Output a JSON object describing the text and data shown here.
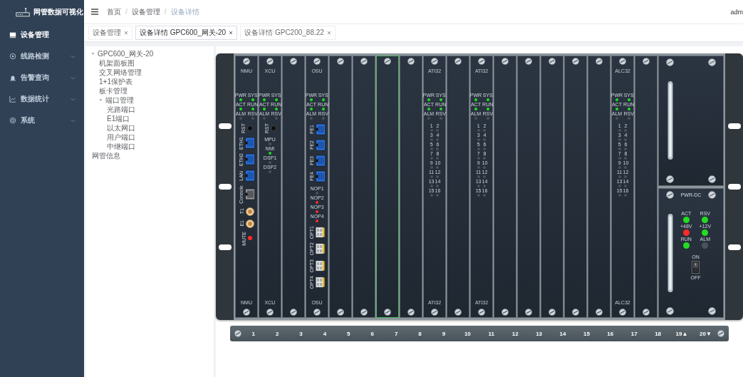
{
  "sidebar": {
    "title": "网管数据可视化",
    "items": [
      {
        "label": "设备管理",
        "selected": true,
        "has_children": false
      },
      {
        "label": "线路检测",
        "selected": false,
        "has_children": true
      },
      {
        "label": "告警查询",
        "selected": false,
        "has_children": true
      },
      {
        "label": "数据统计",
        "selected": false,
        "has_children": true
      },
      {
        "label": "系统",
        "selected": false,
        "has_children": true
      }
    ]
  },
  "breadcrumb": [
    "首页",
    "设备管理",
    "设备详情"
  ],
  "breadcrumb_separator": "/",
  "user": "adm",
  "tabs": [
    {
      "label": "设备管理",
      "selected": false
    },
    {
      "label": "设备详情 GPC600_网关-20",
      "selected": true
    },
    {
      "label": "设备详情 GPC200_88.22",
      "selected": false
    }
  ],
  "tree": [
    {
      "label": "GPC600_网关-20",
      "expanded": true,
      "children": [
        {
          "label": "机架面板图"
        },
        {
          "label": "交叉网络管理"
        },
        {
          "label": "1+1保护表"
        },
        {
          "label": "板卡管理"
        },
        {
          "label": "端口管理",
          "expanded": true,
          "children": [
            {
              "label": "光路端口"
            },
            {
              "label": "E1端口"
            },
            {
              "label": "以太网口"
            },
            {
              "label": "用户端口"
            },
            {
              "label": "中继端口"
            }
          ]
        }
      ]
    },
    {
      "label": "网管信息"
    }
  ],
  "rack": {
    "slots": [
      {
        "top_label": "NMU",
        "bottom_label": "NMU",
        "selected": false,
        "items": [
          {
            "kind": "led_grid",
            "leds": [
              {
                "label": "PWR",
                "color": "#22dd22"
              },
              {
                "label": "SYS",
                "color": "#22dd22"
              },
              {
                "label": "ACT",
                "color": "#22dd22"
              },
              {
                "label": "RUN",
                "color": "#22dd22"
              },
              {
                "label": "ALM",
                "color": "#4a525b"
              },
              {
                "label": "RSV",
                "color": "#4a525b"
              }
            ]
          },
          {
            "kind": "reset",
            "label": "RST"
          },
          {
            "kind": "rj45",
            "label": "ETH1"
          },
          {
            "kind": "rj45",
            "label": "ETH2"
          },
          {
            "kind": "rj45",
            "label": "LAN"
          },
          {
            "kind": "console",
            "label": "Console"
          },
          {
            "kind": "coax",
            "label": "T1"
          },
          {
            "kind": "coax",
            "label": "E1"
          },
          {
            "kind": "led",
            "label": "MUTE",
            "color": "#ff2a2a"
          }
        ]
      },
      {
        "top_label": "XCU",
        "bottom_label": "XCU",
        "selected": false,
        "items": [
          {
            "kind": "led_grid",
            "leds": [
              {
                "label": "PWR",
                "color": "#22dd22"
              },
              {
                "label": "SYS",
                "color": "#22dd22"
              },
              {
                "label": "ACT",
                "color": "#22dd22"
              },
              {
                "label": "RUN",
                "color": "#22dd22"
              },
              {
                "label": "ALM",
                "color": "#4a525b"
              },
              {
                "label": "RSV",
                "color": "#4a525b"
              }
            ]
          },
          {
            "kind": "reset",
            "label": "RST"
          },
          {
            "kind": "led_grid",
            "leds": [
              {
                "label": "MPU",
                "color": "#4a525b"
              },
              {
                "label": "NMI",
                "color": "#22dd22"
              },
              {
                "label": "DSP1",
                "color": "#4a525b"
              },
              {
                "label": "DSP2",
                "color": "#4a525b"
              }
            ]
          }
        ]
      },
      {
        "selected": false
      },
      {
        "top_label": "OSU",
        "bottom_label": "OSU",
        "selected": false,
        "items": [
          {
            "kind": "led_grid",
            "leds": [
              {
                "label": "PWR",
                "color": "#22dd22"
              },
              {
                "label": "SYS",
                "color": "#22dd22"
              },
              {
                "label": "ACT",
                "color": "#22dd22"
              },
              {
                "label": "RUN",
                "color": "#22dd22"
              },
              {
                "label": "ALM",
                "color": "#4a525b"
              },
              {
                "label": "RSV",
                "color": "#4a525b"
              }
            ]
          },
          {
            "kind": "rj45",
            "label": "FE1"
          },
          {
            "kind": "rj45",
            "label": "FE2"
          },
          {
            "kind": "rj45",
            "label": "FE3"
          },
          {
            "kind": "rj45",
            "label": "FE4"
          },
          {
            "kind": "led_grid",
            "leds": [
              {
                "label": "NOP1",
                "color": "#4a525b"
              },
              {
                "label": "NOP2",
                "color": "#ff2a2a"
              },
              {
                "label": "NOP3",
                "color": "#ff2a2a"
              },
              {
                "label": "NOP4",
                "color": "#ff2a2a"
              }
            ]
          },
          {
            "kind": "sfp",
            "label": "OPT1"
          },
          {
            "kind": "sfp",
            "label": "OPT2"
          },
          {
            "kind": "sfp",
            "label": "OPT3"
          },
          {
            "kind": "sfp",
            "label": "OPT4"
          }
        ]
      },
      {
        "selected": false
      },
      {
        "selected": false
      },
      {
        "selected": true
      },
      {
        "selected": false
      },
      {
        "top_label": "ATI32",
        "bottom_label": "ATI32",
        "selected": false,
        "items": [
          {
            "kind": "led_grid",
            "leds": [
              {
                "label": "PWR",
                "color": "#22dd22"
              },
              {
                "label": "SYS",
                "color": "#22dd22"
              },
              {
                "label": "ACT",
                "color": "#22dd22"
              },
              {
                "label": "RUN",
                "color": "#22dd22"
              },
              {
                "label": "ALM",
                "color": "#4a525b"
              },
              {
                "label": "RSV",
                "color": "#4a525b"
              }
            ]
          },
          {
            "kind": "led_grid",
            "leds": [
              {
                "label": "1",
                "color": "#4a525b"
              },
              {
                "label": "2",
                "color": "#4a525b"
              },
              {
                "label": "3",
                "color": "#4a525b"
              },
              {
                "label": "4",
                "color": "#4a525b"
              },
              {
                "label": "5",
                "color": "#4a525b"
              },
              {
                "label": "6",
                "color": "#4a525b"
              },
              {
                "label": "7",
                "color": "#4a525b"
              },
              {
                "label": "8",
                "color": "#4a525b"
              },
              {
                "label": "9",
                "color": "#4a525b"
              },
              {
                "label": "10",
                "color": "#4a525b"
              },
              {
                "label": "11",
                "color": "#4a525b"
              },
              {
                "label": "12",
                "color": "#4a525b"
              },
              {
                "label": "13",
                "color": "#4a525b"
              },
              {
                "label": "14",
                "color": "#4a525b"
              },
              {
                "label": "15",
                "color": "#4a525b"
              },
              {
                "label": "16",
                "color": "#4a525b"
              }
            ]
          }
        ]
      },
      {
        "selected": false
      },
      {
        "top_label": "ATI32",
        "bottom_label": "ATI32",
        "selected": false,
        "items": [
          {
            "kind": "led_grid",
            "leds": [
              {
                "label": "PWR",
                "color": "#22dd22"
              },
              {
                "label": "SYS",
                "color": "#22dd22"
              },
              {
                "label": "ACT",
                "color": "#22dd22"
              },
              {
                "label": "RUN",
                "color": "#22dd22"
              },
              {
                "label": "ALM",
                "color": "#4a525b"
              },
              {
                "label": "RSV",
                "color": "#4a525b"
              }
            ]
          },
          {
            "kind": "led_grid",
            "leds": [
              {
                "label": "1",
                "color": "#4a525b"
              },
              {
                "label": "2",
                "color": "#4a525b"
              },
              {
                "label": "3",
                "color": "#4a525b"
              },
              {
                "label": "4",
                "color": "#4a525b"
              },
              {
                "label": "5",
                "color": "#4a525b"
              },
              {
                "label": "6",
                "color": "#4a525b"
              },
              {
                "label": "7",
                "color": "#4a525b"
              },
              {
                "label": "8",
                "color": "#4a525b"
              },
              {
                "label": "9",
                "color": "#4a525b"
              },
              {
                "label": "10",
                "color": "#4a525b"
              },
              {
                "label": "11",
                "color": "#4a525b"
              },
              {
                "label": "12",
                "color": "#4a525b"
              },
              {
                "label": "13",
                "color": "#4a525b"
              },
              {
                "label": "14",
                "color": "#4a525b"
              },
              {
                "label": "15",
                "color": "#4a525b"
              },
              {
                "label": "16",
                "color": "#4a525b"
              }
            ]
          }
        ]
      },
      {
        "selected": false
      },
      {
        "selected": false
      },
      {
        "selected": false
      },
      {
        "selected": false
      },
      {
        "selected": false
      },
      {
        "top_label": "ALC32",
        "bottom_label": "ALC32",
        "selected": false,
        "items": [
          {
            "kind": "led_grid",
            "leds": [
              {
                "label": "PWR",
                "color": "#22dd22"
              },
              {
                "label": "SYS",
                "color": "#22dd22"
              },
              {
                "label": "ACT",
                "color": "#22dd22"
              },
              {
                "label": "RUN",
                "color": "#22dd22"
              },
              {
                "label": "ALM",
                "color": "#4a525b"
              },
              {
                "label": "RSV",
                "color": "#4a525b"
              }
            ]
          },
          {
            "kind": "led_grid",
            "leds": [
              {
                "label": "1",
                "color": "#4a525b"
              },
              {
                "label": "2",
                "color": "#4a525b"
              },
              {
                "label": "3",
                "color": "#4a525b"
              },
              {
                "label": "4",
                "color": "#4a525b"
              },
              {
                "label": "5",
                "color": "#4a525b"
              },
              {
                "label": "6",
                "color": "#4a525b"
              },
              {
                "label": "7",
                "color": "#4a525b"
              },
              {
                "label": "8",
                "color": "#4a525b"
              },
              {
                "label": "9",
                "color": "#4a525b"
              },
              {
                "label": "10",
                "color": "#4a525b"
              },
              {
                "label": "11",
                "color": "#4a525b"
              },
              {
                "label": "12",
                "color": "#4a525b"
              },
              {
                "label": "13",
                "color": "#4a525b"
              },
              {
                "label": "14",
                "color": "#4a525b"
              },
              {
                "label": "15",
                "color": "#4a525b"
              },
              {
                "label": "16",
                "color": "#4a525b"
              }
            ]
          }
        ]
      },
      {
        "selected": false
      }
    ],
    "power": {
      "label": "PWR-DC",
      "leds": [
        {
          "label": "ACT",
          "color": "#22dd22"
        },
        {
          "label": "RSV",
          "color": "#22dd22"
        },
        {
          "label": "+48V",
          "color": "#ff2a2a"
        },
        {
          "label": "+12V",
          "color": "#22dd22"
        },
        {
          "label": "RUN",
          "color": "#22dd22"
        },
        {
          "label": "ALM",
          "color": "#4a525b"
        }
      ],
      "switch": {
        "on_label": "ON",
        "off_label": "OFF",
        "on": true
      }
    },
    "slot_numbers": [
      "1",
      "2",
      "3",
      "4",
      "5",
      "6",
      "7",
      "8",
      "9",
      "10",
      "11",
      "12",
      "13",
      "14",
      "15",
      "16",
      "17",
      "18",
      "19▲",
      "20▼"
    ]
  }
}
